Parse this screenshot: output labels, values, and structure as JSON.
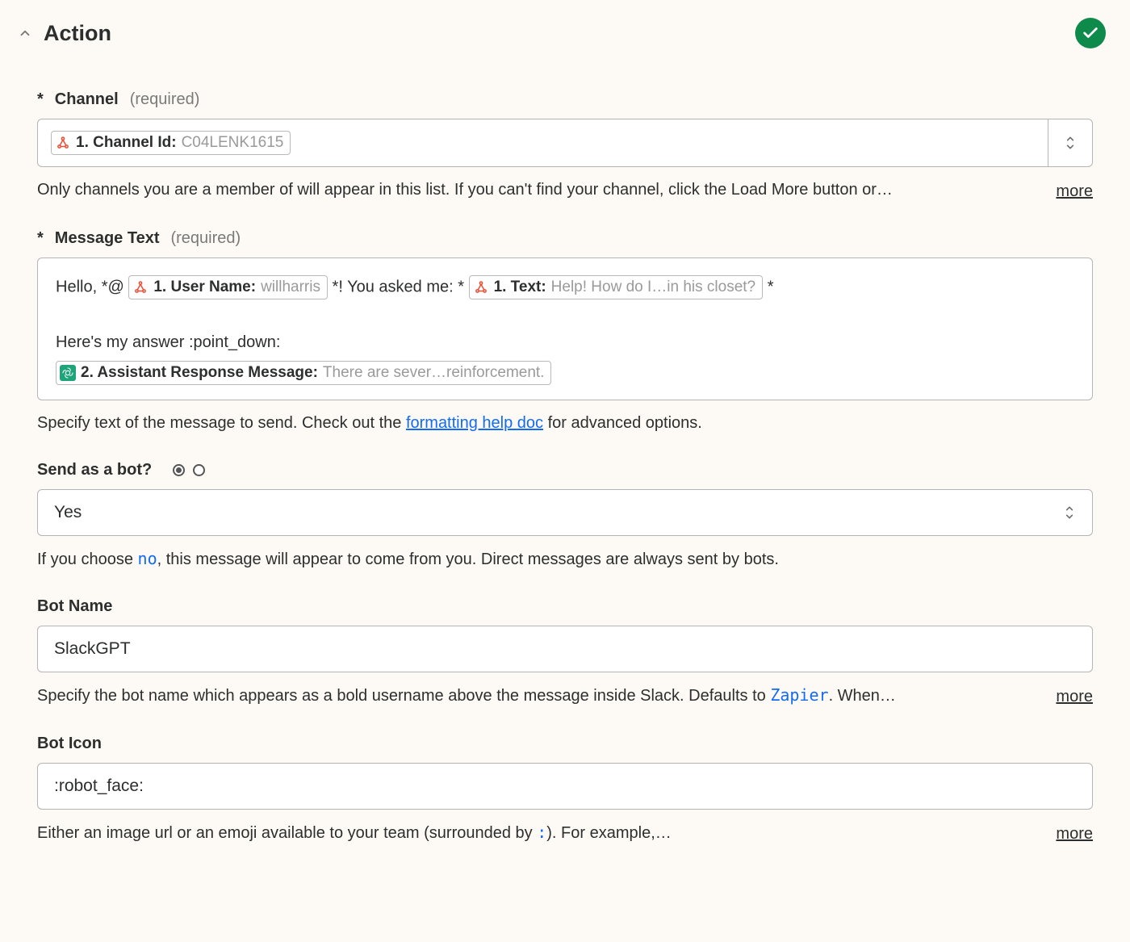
{
  "header": {
    "title": "Action"
  },
  "required_label": "(required)",
  "channel": {
    "label": "Channel",
    "pill_label": "1. Channel Id:",
    "pill_value": "C04LENK1615",
    "hint": "Only channels you are a member of will appear in this list. If you can't find your channel, click the Load More button or…",
    "more": "more"
  },
  "message": {
    "label": "Message Text",
    "text_before_user": "Hello, *@",
    "user_pill_label": "1. User Name:",
    "user_pill_value": "willharris",
    "text_mid": "*! You asked me: *",
    "text_pill_label": "1. Text:",
    "text_pill_value": "Help! How do I…in his closet?",
    "text_after_text": "*",
    "line2": "Here's my answer :point_down:",
    "assistant_pill_label": "2. Assistant Response Message:",
    "assistant_pill_value": "There are sever…reinforcement.",
    "hint_before": "Specify text of the message to send. Check out the ",
    "hint_link": "formatting help doc",
    "hint_after": " for advanced options."
  },
  "send_bot": {
    "label": "Send as a bot?",
    "value": "Yes",
    "hint_before": "If you choose ",
    "hint_code": "no",
    "hint_after": ", this message will appear to come from you. Direct messages are always sent by bots."
  },
  "bot_name": {
    "label": "Bot Name",
    "value": "SlackGPT",
    "hint_before": "Specify the bot name which appears as a bold username above the message inside Slack. Defaults to ",
    "hint_code": "Zapier",
    "hint_after": ". When…",
    "more": "more"
  },
  "bot_icon": {
    "label": "Bot Icon",
    "value": ":robot_face:",
    "hint_before": "Either an image url or an emoji available to your team (surrounded by ",
    "hint_code": ":",
    "hint_after": "). For example,…",
    "more": "more"
  }
}
